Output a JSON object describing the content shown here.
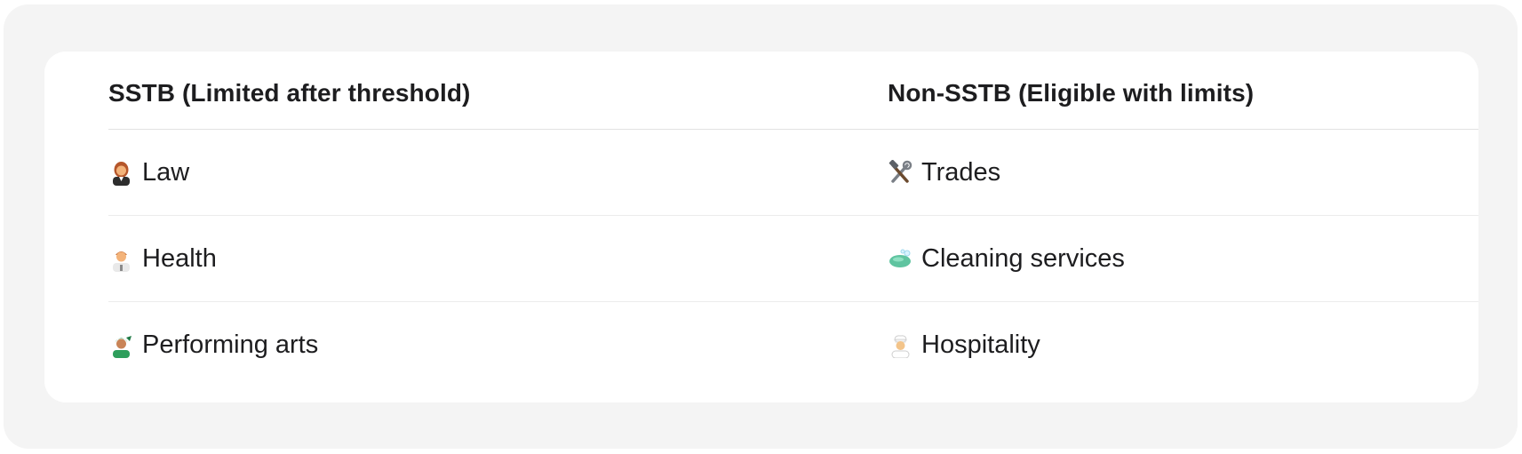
{
  "table": {
    "headers": [
      "SSTB (Limited after threshold)",
      "Non-SSTB (Eligible with limits)"
    ],
    "rows": [
      {
        "sstb": {
          "icon": "judge-person-icon",
          "label": "Law"
        },
        "non_sstb": {
          "icon": "hammer-and-wrench-icon",
          "label": "Trades"
        }
      },
      {
        "sstb": {
          "icon": "health-worker-icon",
          "label": "Health"
        },
        "non_sstb": {
          "icon": "soap-icon",
          "label": "Cleaning services"
        }
      },
      {
        "sstb": {
          "icon": "performer-person-icon",
          "label": "Performing arts"
        },
        "non_sstb": {
          "icon": "cook-icon",
          "label": "Hospitality"
        }
      }
    ]
  }
}
